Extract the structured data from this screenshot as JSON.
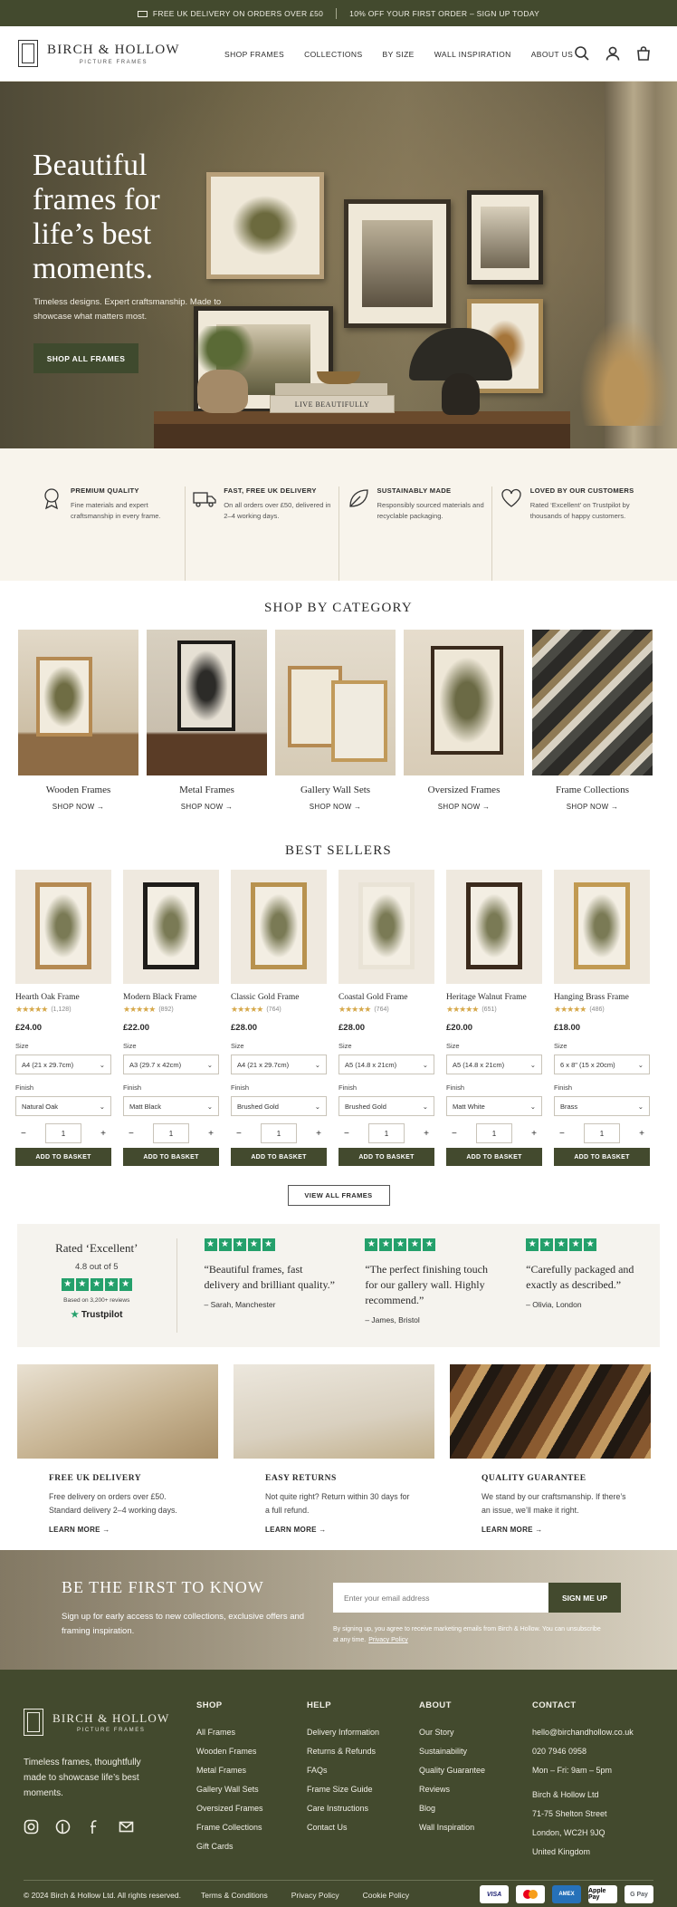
{
  "topbar": {
    "left": "FREE UK DELIVERY ON ORDERS OVER £50",
    "right": "10% OFF YOUR FIRST ORDER – SIGN UP TODAY"
  },
  "brand": {
    "name": "BIRCH & HOLLOW",
    "tagline": "PICTURE FRAMES"
  },
  "nav": [
    "SHOP FRAMES",
    "COLLECTIONS",
    "BY SIZE",
    "WALL INSPIRATION",
    "ABOUT US"
  ],
  "header_icons": [
    "search-icon",
    "account-icon",
    "basket-icon"
  ],
  "hero": {
    "title": "Beautiful frames for life’s best moments.",
    "subtitle": "Timeless designs. Expert craftsmanship. Made to showcase what matters most.",
    "cta": "SHOP ALL FRAMES",
    "book_text": "LIVE BEAUTIFULLY"
  },
  "features": [
    {
      "icon": "badge-icon",
      "title": "PREMIUM QUALITY",
      "text": "Fine materials and expert craftsmanship in every frame."
    },
    {
      "icon": "truck-icon",
      "title": "FAST, FREE UK DELIVERY",
      "text": "On all orders over £50, delivered in 2–4 working days."
    },
    {
      "icon": "leaf-icon",
      "title": "SUSTAINABLY MADE",
      "text": "Responsibly sourced materials and recyclable packaging."
    },
    {
      "icon": "heart-icon",
      "title": "LOVED BY OUR CUSTOMERS",
      "text": "Rated ‘Excellent’ on Trustpilot by thousands of happy customers."
    }
  ],
  "categories": {
    "title": "SHOP BY CATEGORY",
    "items": [
      {
        "name": "Wooden Frames",
        "link": "SHOP NOW →"
      },
      {
        "name": "Metal Frames",
        "link": "SHOP NOW →"
      },
      {
        "name": "Gallery Wall Sets",
        "link": "SHOP NOW →"
      },
      {
        "name": "Oversized Frames",
        "link": "SHOP NOW →"
      },
      {
        "name": "Frame Collections",
        "link": "SHOP NOW →"
      }
    ]
  },
  "bestsellers": {
    "title": "BEST SELLERS",
    "size_label": "Size",
    "finish_label": "Finish",
    "add_label": "ADD TO BASKET",
    "view_all": "VIEW ALL FRAMES",
    "products": [
      {
        "name": "Hearth Oak Frame",
        "stars": "★★★★★",
        "count": "(1,128)",
        "price": "£24.00",
        "size": "A4 (21 x 29.7cm)",
        "finish": "Natural Oak",
        "qty": "1",
        "frame_color": "#b58a52"
      },
      {
        "name": "Modern Black Frame",
        "stars": "★★★★★",
        "count": "(892)",
        "price": "£22.00",
        "size": "A3 (29.7 x 42cm)",
        "finish": "Matt Black",
        "qty": "1",
        "frame_color": "#1f1d1a"
      },
      {
        "name": "Classic Gold Frame",
        "stars": "★★★★★",
        "count": "(764)",
        "price": "£28.00",
        "size": "A4 (21 x 29.7cm)",
        "finish": "Brushed Gold",
        "qty": "1",
        "frame_color": "#b8924f"
      },
      {
        "name": "Coastal Gold Frame",
        "stars": "★★★★★",
        "count": "(764)",
        "price": "£28.00",
        "size": "A5 (14.8 x 21cm)",
        "finish": "Brushed Gold",
        "qty": "1",
        "frame_color": "#e9e3d6"
      },
      {
        "name": "Heritage Walnut Frame",
        "stars": "★★★★★",
        "count": "(651)",
        "price": "£20.00",
        "size": "A5 (14.8 x 21cm)",
        "finish": "Matt White",
        "qty": "1",
        "frame_color": "#3b2a1c"
      },
      {
        "name": "Hanging Brass Frame",
        "stars": "★★★★★",
        "count": "(486)",
        "price": "£18.00",
        "size": "6 x 8\" (15 x 20cm)",
        "finish": "Brass",
        "qty": "1",
        "frame_color": "#c19a52"
      }
    ]
  },
  "reviews": {
    "rated": "Rated ‘Excellent’",
    "score": "4.8 out of 5",
    "based": "Based on 3,200+ reviews",
    "brand": "Trustpilot",
    "quotes": [
      {
        "text": "“Beautiful frames, fast delivery and brilliant quality.”",
        "author": "– Sarah, Manchester"
      },
      {
        "text": "“The perfect finishing touch for our gallery wall. Highly recommend.”",
        "author": "– James, Bristol"
      },
      {
        "text": "“Carefully packaged and exactly as described.”",
        "author": "– Olivia, London"
      }
    ]
  },
  "promos": [
    {
      "title": "FREE UK DELIVERY",
      "text": "Free delivery on orders over £50. Standard delivery 2–4 working days.",
      "link": "LEARN MORE →"
    },
    {
      "title": "EASY RETURNS",
      "text": "Not quite right? Return within 30 days for a full refund.",
      "link": "LEARN MORE →"
    },
    {
      "title": "QUALITY GUARANTEE",
      "text": "We stand by our craftsmanship. If there’s an issue, we’ll make it right.",
      "link": "LEARN MORE →"
    }
  ],
  "newsletter": {
    "title": "BE THE FIRST TO KNOW",
    "text": "Sign up for early access to new collections, exclusive offers and framing inspiration.",
    "placeholder": "Enter your email address",
    "button": "SIGN ME UP",
    "fine": "By signing up, you agree to receive marketing emails from Birch & Hollow. You can unsubscribe at any time.",
    "privacy": "Privacy Policy"
  },
  "footer": {
    "tagline": "Timeless frames, thoughtfully made to showcase life’s best moments.",
    "social": [
      "instagram-icon",
      "pinterest-icon",
      "facebook-icon",
      "email-icon"
    ],
    "shop": {
      "title": "SHOP",
      "links": [
        "All Frames",
        "Wooden Frames",
        "Metal Frames",
        "Gallery Wall Sets",
        "Oversized Frames",
        "Frame Collections",
        "Gift Cards"
      ]
    },
    "help": {
      "title": "HELP",
      "links": [
        "Delivery Information",
        "Returns & Refunds",
        "FAQs",
        "Frame Size Guide",
        "Care Instructions",
        "Contact Us"
      ]
    },
    "about": {
      "title": "ABOUT",
      "links": [
        "Our Story",
        "Sustainability",
        "Quality Guarantee",
        "Reviews",
        "Blog",
        "Wall Inspiration"
      ]
    },
    "contact": {
      "title": "CONTACT",
      "lines": [
        "hello@birchandhollow.co.uk",
        "020 7946 0958",
        "Mon – Fri: 9am – 5pm",
        "Birch & Hollow Ltd",
        "71-75 Shelton Street",
        "London, WC2H 9JQ",
        "United Kingdom"
      ]
    },
    "copyright": "© 2024 Birch & Hollow Ltd. All rights reserved.",
    "legal": [
      "Terms & Conditions",
      "Privacy Policy",
      "Cookie Policy"
    ],
    "payments": [
      "VISA",
      "Mastercard",
      "AMEX",
      "Apple Pay",
      "G Pay"
    ]
  }
}
